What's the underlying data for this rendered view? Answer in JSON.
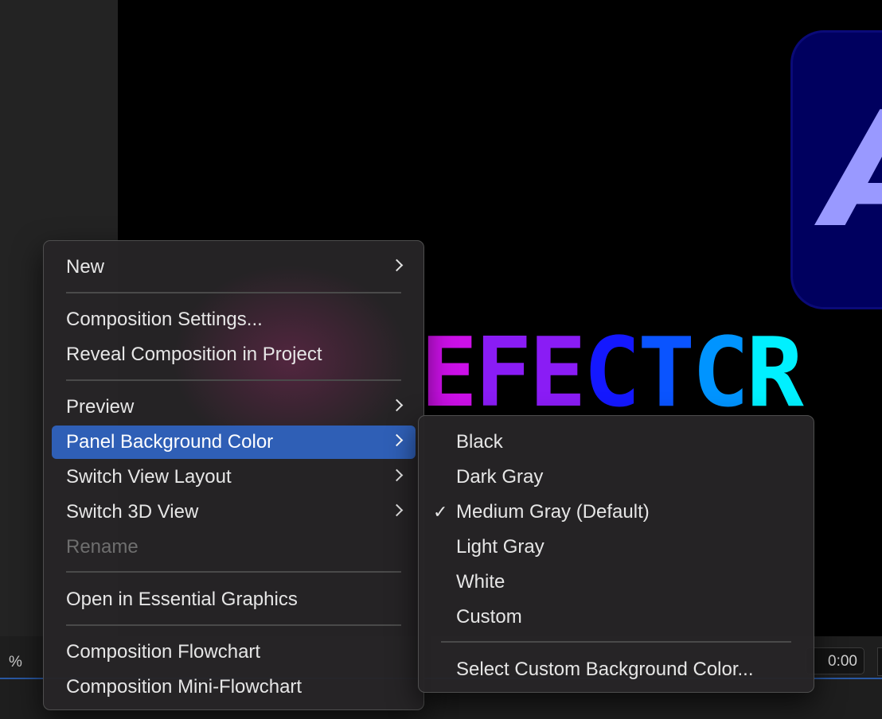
{
  "status_bar": {
    "zoom_suffix": "%",
    "timecode": "0:00"
  },
  "preview": {
    "logo_letter": "A",
    "title_letters": [
      {
        "ch": "E",
        "color": "#cc10e8"
      },
      {
        "ch": "F",
        "color": "#8a1cf5"
      },
      {
        "ch": "E",
        "color": "#8a1cf5"
      },
      {
        "ch": "C",
        "color": "#1418ff"
      },
      {
        "ch": "T",
        "color": "#0a54ff"
      },
      {
        "ch": "C",
        "color": "#0094ff"
      },
      {
        "ch": "R",
        "color": "#00f0ff"
      }
    ]
  },
  "context_menu": {
    "items": [
      {
        "label": "New"
      },
      {
        "label": "Composition Settings..."
      },
      {
        "label": "Reveal Composition in Project"
      },
      {
        "label": "Preview"
      },
      {
        "label": "Panel Background Color"
      },
      {
        "label": "Switch View Layout"
      },
      {
        "label": "Switch 3D View"
      },
      {
        "label": "Rename"
      },
      {
        "label": "Open in Essential Graphics"
      },
      {
        "label": "Composition Flowchart"
      },
      {
        "label": "Composition Mini-Flowchart"
      }
    ]
  },
  "submenu": {
    "check_mark": "✓",
    "items": [
      {
        "label": "Black"
      },
      {
        "label": "Dark Gray"
      },
      {
        "label": "Medium Gray (Default)"
      },
      {
        "label": "Light Gray"
      },
      {
        "label": "White"
      },
      {
        "label": "Custom"
      },
      {
        "label": "Select Custom Background Color..."
      }
    ]
  },
  "colors": {
    "selection": "#2f5fb6",
    "menu_bg": "#262426",
    "viewer_bg": "#000000"
  }
}
